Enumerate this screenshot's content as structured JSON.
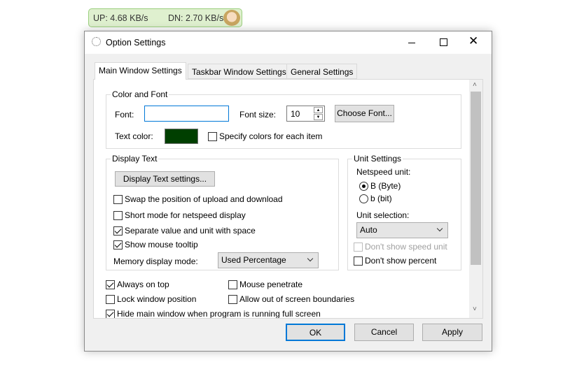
{
  "speed_widget": {
    "up": "UP: 4.68 KB/s",
    "down": "DN: 2.70 KB/s"
  },
  "dialog": {
    "title": "Option Settings",
    "tabs": [
      "Main Window Settings",
      "Taskbar Window Settings",
      "General Settings"
    ],
    "color_font": {
      "legend": "Color and Font",
      "font_label": "Font:",
      "font_value": "",
      "font_size_label": "Font size:",
      "font_size_value": "10",
      "choose_font": "Choose Font...",
      "text_color_label": "Text color:",
      "text_color": "#003f00",
      "specify_colors": "Specify colors for each item"
    },
    "display_text": {
      "legend": "Display Text",
      "settings_button": "Display Text settings...",
      "options": [
        {
          "label": "Swap the position of upload and download",
          "checked": false
        },
        {
          "label": "Short mode for netspeed display",
          "checked": false
        },
        {
          "label": "Separate value and unit with space",
          "checked": true
        },
        {
          "label": "Show mouse tooltip",
          "checked": true
        }
      ],
      "memory_label": "Memory display mode:",
      "memory_value": "Used Percentage"
    },
    "unit_settings": {
      "legend": "Unit Settings",
      "netspeed_label": "Netspeed unit:",
      "radios": [
        {
          "label": "B (Byte)",
          "checked": true
        },
        {
          "label": "b (bit)",
          "checked": false
        }
      ],
      "selection_label": "Unit selection:",
      "selection_value": "Auto",
      "dont_show_unit": "Don't show speed unit",
      "dont_show_percent": "Don't show percent"
    },
    "bottom": [
      {
        "label": "Always on top",
        "checked": true
      },
      {
        "label": "Mouse penetrate",
        "checked": false
      },
      {
        "label": "Lock window position",
        "checked": false
      },
      {
        "label": "Allow out of screen boundaries",
        "checked": false
      },
      {
        "label": "Hide main window when program is running full screen",
        "checked": true
      }
    ],
    "buttons": {
      "ok": "OK",
      "cancel": "Cancel",
      "apply": "Apply"
    }
  }
}
